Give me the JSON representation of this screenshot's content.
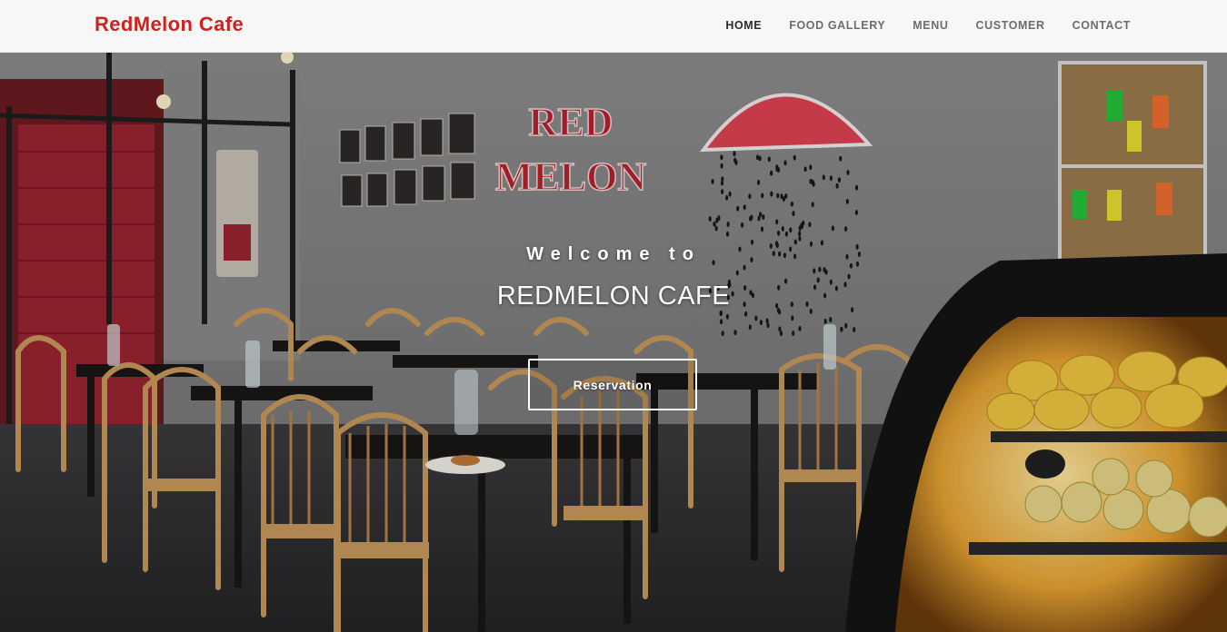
{
  "brand": {
    "name": "RedMelon Cafe",
    "color": "#d0211c"
  },
  "nav": {
    "items": [
      {
        "label": "HOME",
        "active": true
      },
      {
        "label": "FOOD GALLERY",
        "active": false
      },
      {
        "label": "MENU",
        "active": false
      },
      {
        "label": "CUSTOMER",
        "active": false
      },
      {
        "label": "CONTACT",
        "active": false
      }
    ]
  },
  "hero": {
    "welcome": "Welcome to",
    "title": "REDMELON CAFE",
    "button_label": "Reservation",
    "wall_sign": [
      "RED",
      "MELON"
    ]
  }
}
